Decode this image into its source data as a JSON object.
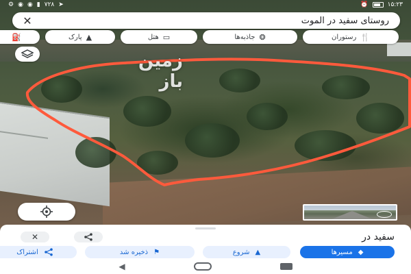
{
  "status_bar": {
    "time": "۱۵:۲۳",
    "badge": "۷۲۸"
  },
  "search": {
    "query": "روستای سفید در الموت"
  },
  "chips": [
    {
      "id": "restaurant",
      "label": "رستوران",
      "icon": "fork-knife-icon"
    },
    {
      "id": "attractions",
      "label": "جاذبه‌ها",
      "icon": "camera-icon"
    },
    {
      "id": "hotel",
      "label": "هتل",
      "icon": "bed-icon"
    },
    {
      "id": "park",
      "label": "پارک",
      "icon": "tree-icon"
    },
    {
      "id": "more",
      "label": "",
      "icon": "fuel-icon"
    }
  ],
  "map": {
    "watermark": "زمین باز",
    "boundary_color": "#ff5a3c"
  },
  "sheet": {
    "title": "سفید در",
    "actions": [
      {
        "id": "directions",
        "label": "مسیرها",
        "icon": "directions-icon",
        "style": "primary"
      },
      {
        "id": "start",
        "label": "شروع",
        "icon": "navigation-arrow-icon",
        "style": "secondary"
      },
      {
        "id": "save",
        "label": "ذخیره شد",
        "icon": "bookmark-flag-icon",
        "style": "secondary"
      },
      {
        "id": "share",
        "label": "اشتراک",
        "icon": "share-icon",
        "style": "secondary"
      }
    ]
  },
  "colors": {
    "accent": "#1a73e8",
    "accent_light": "#e8f0fe",
    "boundary": "#ff5a3c"
  }
}
